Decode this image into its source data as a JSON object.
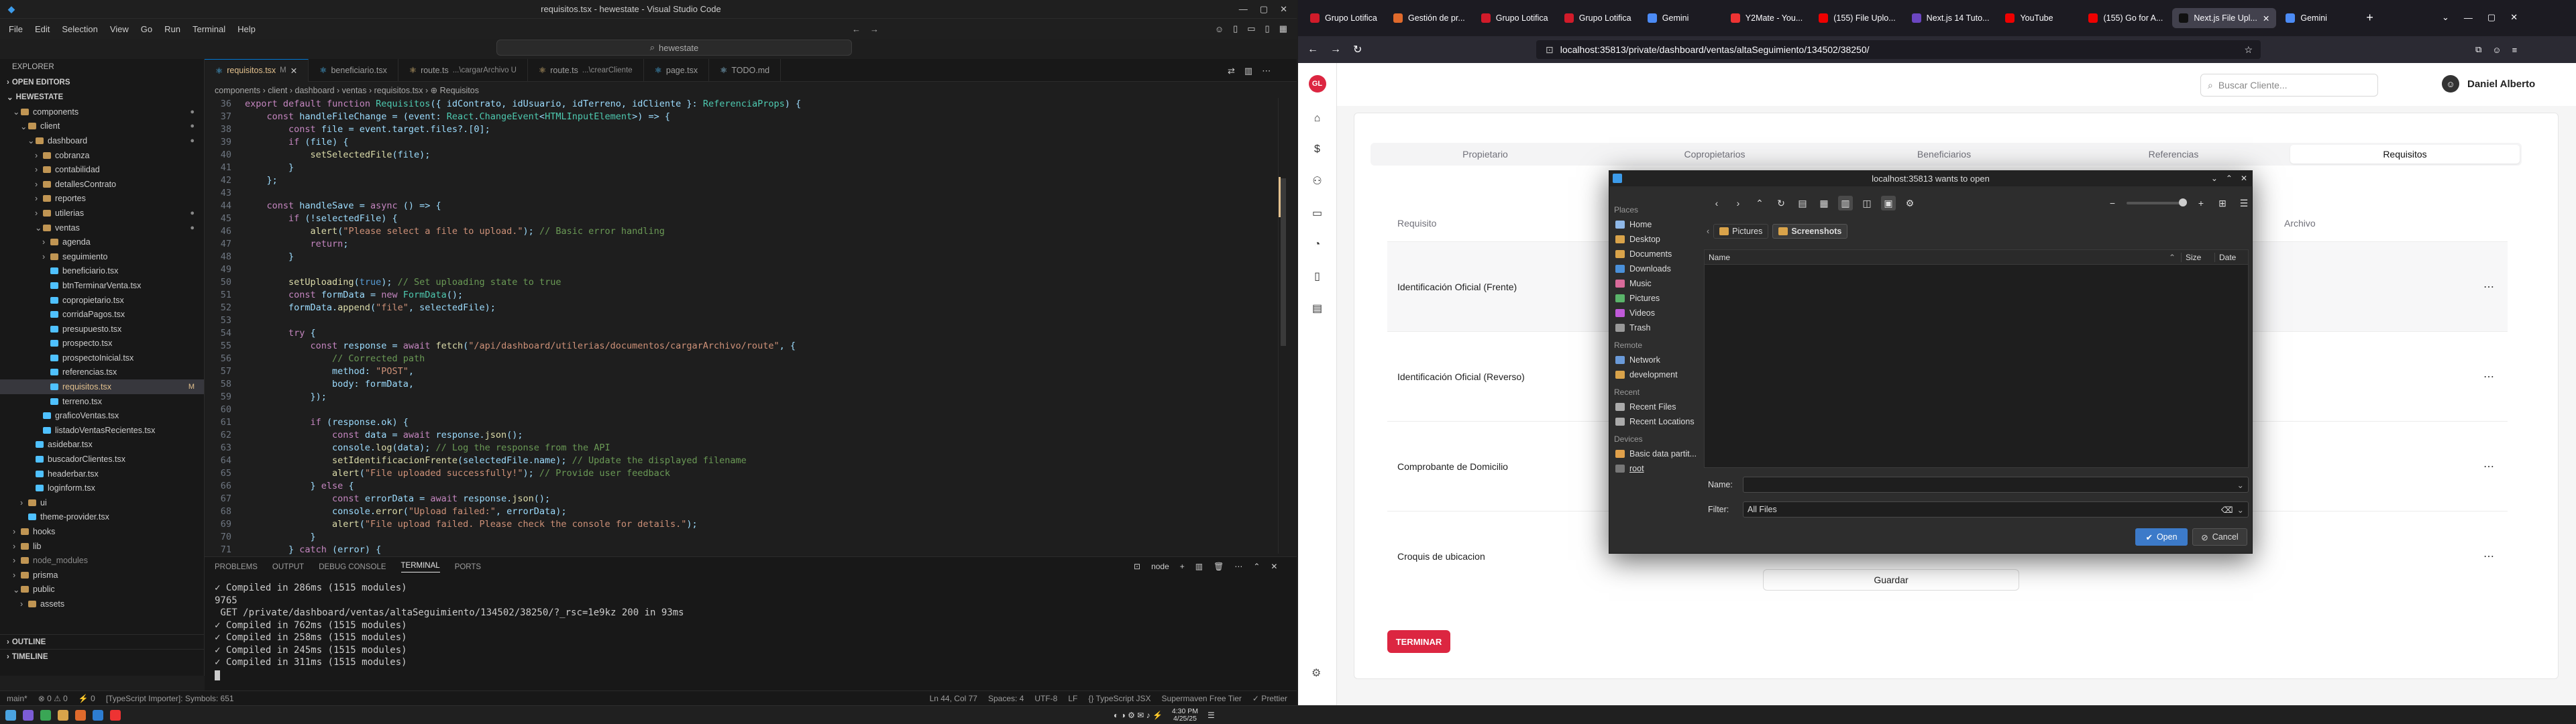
{
  "vscode": {
    "title": "requisitos.tsx - hewestate - Visual Studio Code",
    "menu": [
      "File",
      "Edit",
      "Selection",
      "View",
      "Go",
      "Run",
      "Terminal",
      "Help"
    ],
    "search": "hewestate",
    "explorer": {
      "header": "EXPLORER",
      "open_editors": "OPEN EDITORS",
      "root": "HEWESTATE",
      "items": [
        {
          "label": "components",
          "depth": 1,
          "type": "folder",
          "open": true,
          "badge": "●"
        },
        {
          "label": "client",
          "depth": 2,
          "type": "folder",
          "open": true,
          "badge": "●"
        },
        {
          "label": "dashboard",
          "depth": 3,
          "type": "folder",
          "open": true,
          "badge": "●"
        },
        {
          "label": "cobranza",
          "depth": 4,
          "type": "folder",
          "open": false,
          "badge": ""
        },
        {
          "label": "contabilidad",
          "depth": 4,
          "type": "folder",
          "open": false,
          "badge": ""
        },
        {
          "label": "detallesContrato",
          "depth": 4,
          "type": "folder",
          "open": false,
          "badge": ""
        },
        {
          "label": "reportes",
          "depth": 4,
          "type": "folder",
          "open": false,
          "badge": ""
        },
        {
          "label": "utilerias",
          "depth": 4,
          "type": "folder",
          "open": false,
          "badge": "●"
        },
        {
          "label": "ventas",
          "depth": 4,
          "type": "folder",
          "open": true,
          "badge": "●"
        },
        {
          "label": "agenda",
          "depth": 5,
          "type": "folder",
          "open": false,
          "badge": ""
        },
        {
          "label": "seguimiento",
          "depth": 5,
          "type": "folder",
          "open": false,
          "badge": ""
        },
        {
          "label": "beneficiario.tsx",
          "depth": 5,
          "type": "file",
          "badge": ""
        },
        {
          "label": "btnTerminarVenta.tsx",
          "depth": 5,
          "type": "file",
          "badge": ""
        },
        {
          "label": "copropietario.tsx",
          "depth": 5,
          "type": "file",
          "badge": ""
        },
        {
          "label": "corridaPagos.tsx",
          "depth": 5,
          "type": "file",
          "badge": ""
        },
        {
          "label": "presupuesto.tsx",
          "depth": 5,
          "type": "file",
          "badge": ""
        },
        {
          "label": "prospecto.tsx",
          "depth": 5,
          "type": "file",
          "badge": ""
        },
        {
          "label": "prospectoInicial.tsx",
          "depth": 5,
          "type": "file",
          "badge": ""
        },
        {
          "label": "referencias.tsx",
          "depth": 5,
          "type": "file",
          "badge": ""
        },
        {
          "label": "requisitos.tsx",
          "depth": 5,
          "type": "file",
          "badge": "M",
          "selected": true
        },
        {
          "label": "terreno.tsx",
          "depth": 5,
          "type": "file",
          "badge": ""
        },
        {
          "label": "graficoVentas.tsx",
          "depth": 4,
          "type": "file",
          "badge": ""
        },
        {
          "label": "listadoVentasRecientes.tsx",
          "depth": 4,
          "type": "file",
          "badge": ""
        },
        {
          "label": "asidebar.tsx",
          "depth": 3,
          "type": "file",
          "badge": ""
        },
        {
          "label": "buscadorClientes.tsx",
          "depth": 3,
          "type": "file",
          "badge": ""
        },
        {
          "label": "headerbar.tsx",
          "depth": 3,
          "type": "file",
          "badge": ""
        },
        {
          "label": "loginform.tsx",
          "depth": 3,
          "type": "file",
          "badge": ""
        },
        {
          "label": "ui",
          "depth": 2,
          "type": "folder",
          "open": false,
          "badge": ""
        },
        {
          "label": "theme-provider.tsx",
          "depth": 2,
          "type": "file",
          "badge": ""
        },
        {
          "label": "hooks",
          "depth": 1,
          "type": "folder",
          "open": false,
          "badge": ""
        },
        {
          "label": "lib",
          "depth": 1,
          "type": "folder",
          "open": false,
          "badge": ""
        },
        {
          "label": "node_modules",
          "depth": 1,
          "type": "folder",
          "open": false,
          "badge": ""
        },
        {
          "label": "prisma",
          "depth": 1,
          "type": "folder",
          "open": false,
          "badge": ""
        },
        {
          "label": "public",
          "depth": 1,
          "type": "folder",
          "open": true,
          "badge": ""
        },
        {
          "label": "assets",
          "depth": 2,
          "type": "folder",
          "open": false,
          "badge": ""
        }
      ],
      "outline": "OUTLINE",
      "timeline": "TIMELINE"
    },
    "tabs": [
      {
        "label": "requisitos.tsx",
        "suffix": "M",
        "active": true,
        "color": "#4fc1ff"
      },
      {
        "label": "beneficiario.tsx",
        "suffix": "",
        "active": false,
        "color": "#4fc1ff"
      },
      {
        "label": "route.ts",
        "suffix": "...\\cargarArchivo U",
        "active": false,
        "color": "#e5c07b"
      },
      {
        "label": "route.ts",
        "suffix": "...\\crearCliente",
        "active": false,
        "color": "#e5c07b"
      },
      {
        "label": "page.tsx",
        "suffix": "",
        "active": false,
        "color": "#4fc1ff"
      },
      {
        "label": "TODO.md",
        "suffix": "",
        "active": false,
        "color": "#9cdcfe"
      }
    ],
    "breadcrumb": "components › client › dashboard › ventas › requisitos.tsx › ⊕ Requisitos",
    "code_start_line": 36,
    "code": [
      "export default function Requisitos({ idContrato, idUsuario, idTerreno, idCliente }: ReferenciaProps) {",
      "    const handleFileChange = (event: React.ChangeEvent<HTMLInputElement>) => {",
      "        const file = event.target.files?.[0];",
      "        if (file) {",
      "            setSelectedFile(file);",
      "        }",
      "    };",
      "",
      "    const handleSave = async () => {",
      "        if (!selectedFile) {",
      "            alert(\"Please select a file to upload.\"); // Basic error handling",
      "            return;",
      "        }",
      "",
      "        setUploading(true); // Set uploading state to true",
      "        const formData = new FormData();",
      "        formData.append(\"file\", selectedFile);",
      "",
      "        try {",
      "            const response = await fetch(\"/api/dashboard/utilerias/documentos/cargarArchivo/route\", {",
      "                // Corrected path",
      "                method: \"POST\",",
      "                body: formData,",
      "            });",
      "",
      "            if (response.ok) {",
      "                const data = await response.json();",
      "                console.log(data); // Log the response from the API",
      "                setIdentificacionFrente(selectedFile.name); // Update the displayed filename",
      "                alert(\"File uploaded successfully!\"); // Provide user feedback",
      "            } else {",
      "                const errorData = await response.json();",
      "                console.error(\"Upload failed:\", errorData);",
      "                alert(\"File upload failed. Please check the console for details.\");",
      "            }",
      "        } catch (error) {"
    ],
    "panel_tabs": [
      "PROBLEMS",
      "OUTPUT",
      "DEBUG CONSOLE",
      "TERMINAL",
      "PORTS"
    ],
    "panel_active": "TERMINAL",
    "terminal_shell": "node",
    "terminal": [
      "✓ Compiled in 286ms (1515 modules)",
      "9765",
      " GET /private/dashboard/ventas/altaSeguimiento/134502/38250/?_rsc=1e9kz 200 in 93ms",
      "✓ Compiled in 762ms (1515 modules)",
      "✓ Compiled in 258ms (1515 modules)",
      "✓ Compiled in 245ms (1515 modules)",
      "✓ Compiled in 311ms (1515 modules)"
    ],
    "status_left": [
      "main*",
      "⊗ 0 ⚠ 0",
      "⚡ 0",
      "[TypeScript Importer]: Symbols: 651"
    ],
    "status_right": [
      "Ln 44, Col 77",
      "Spaces: 4",
      "UTF-8",
      "LF",
      "{} TypeScript JSX",
      "Supermaven Free Tier",
      "✓ Prettier"
    ]
  },
  "browser": {
    "tabs": [
      {
        "label": "Grupo Lotifica",
        "color": "#d11b2a",
        "active": false
      },
      {
        "label": "Gestión de pr...",
        "color": "#e06a2c",
        "active": false
      },
      {
        "label": "Grupo Lotifica",
        "color": "#d11b2a",
        "active": false
      },
      {
        "label": "Grupo Lotifica",
        "color": "#d11b2a",
        "active": false
      },
      {
        "label": "Gemini",
        "color": "#4c8bf5",
        "active": false
      },
      {
        "label": "Y2Mate - You...",
        "color": "#e33",
        "active": false
      },
      {
        "label": "(155) File Uplo...",
        "color": "#e00",
        "active": false
      },
      {
        "label": "Next.js 14 Tuto...",
        "color": "#6b46c1",
        "active": false
      },
      {
        "label": "YouTube",
        "color": "#e00",
        "active": false
      },
      {
        "label": "(155) Go for A...",
        "color": "#e00",
        "active": false
      },
      {
        "label": "Next.js File Upl...",
        "color": "#111",
        "active": true
      },
      {
        "label": "Gemini",
        "color": "#4c8bf5",
        "active": false
      }
    ],
    "url": "localhost:35813/private/dashboard/ventas/altaSeguimiento/134502/38250/",
    "page": {
      "search_placeholder": "Buscar Cliente...",
      "user": "Daniel Alberto",
      "tabs": [
        "Propietario",
        "Copropietarios",
        "Beneficiarios",
        "Referencias",
        "Requisitos"
      ],
      "active_tab": "Requisitos",
      "col_requisito": "Requisito",
      "col_archivo": "Archivo",
      "rows": [
        "Identificación Oficial (Frente)",
        "Identificación Oficial (Reverso)",
        "Comprobante de Domicilio",
        "Croquis de ubicacion"
      ],
      "save_label": "Guardar",
      "finish_label": "TERMINAR",
      "brand_color": "#dc2641"
    },
    "dialog": {
      "title": "localhost:35813 wants to open",
      "places_head": "Places",
      "places": [
        {
          "label": "Home",
          "icon": "home-icon"
        },
        {
          "label": "Desktop",
          "icon": "folder-icon"
        },
        {
          "label": "Documents",
          "icon": "folder-icon"
        },
        {
          "label": "Downloads",
          "icon": "download-icon"
        },
        {
          "label": "Music",
          "icon": "music-icon"
        },
        {
          "label": "Pictures",
          "icon": "pictures-icon"
        },
        {
          "label": "Videos",
          "icon": "video-icon"
        },
        {
          "label": "Trash",
          "icon": "trash-icon"
        }
      ],
      "remote_head": "Remote",
      "remote": [
        {
          "label": "Network"
        },
        {
          "label": "development"
        }
      ],
      "recent_head": "Recent",
      "recent": [
        {
          "label": "Recent Files"
        },
        {
          "label": "Recent Locations"
        }
      ],
      "devices_head": "Devices",
      "devices": [
        {
          "label": "Basic data partit..."
        },
        {
          "label": "root"
        }
      ],
      "path": [
        "Pictures",
        "Screenshots"
      ],
      "col_name": "Name",
      "col_size": "Size",
      "col_date": "Date",
      "name_label": "Name:",
      "name_value": "",
      "filter_label": "Filter:",
      "filter_value": "All Files",
      "open_label": "Open",
      "cancel_label": "Cancel"
    }
  },
  "taskbar": {
    "time": "4:30 PM",
    "date": "4/25/25"
  }
}
